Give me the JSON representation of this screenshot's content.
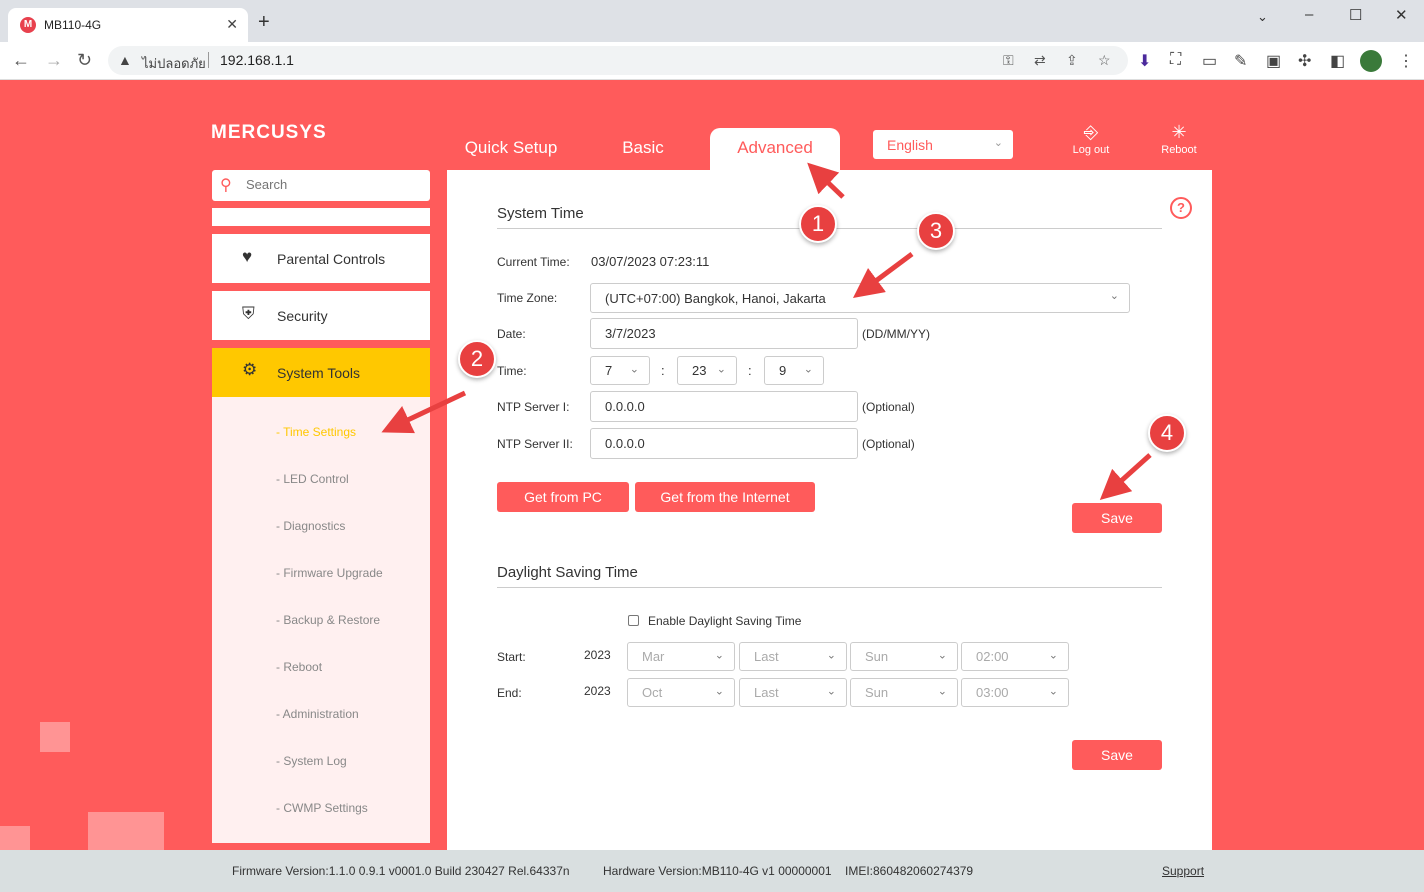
{
  "browser": {
    "tab_title": "MB110-4G",
    "favicon_letter": "M",
    "close_glyph": "✕",
    "new_tab_glyph": "+",
    "win_min": "–",
    "win_max": "☐",
    "win_close": "✕",
    "security_label": "ไม่ปลอดภัย",
    "url": "192.168.1.1"
  },
  "header": {
    "logo": "MERCUSYS",
    "tabs": [
      "Quick Setup",
      "Basic",
      "Advanced"
    ],
    "language": "English",
    "logout": "Log out",
    "reboot": "Reboot"
  },
  "sidebar": {
    "search_placeholder": "Search",
    "items": [
      {
        "label": "Parental Controls",
        "icon": "heart-icon"
      },
      {
        "label": "Security",
        "icon": "shield-icon"
      },
      {
        "label": "System Tools",
        "icon": "gear-icon"
      }
    ],
    "sub_items": [
      "- Time Settings",
      "- LED Control",
      "- Diagnostics",
      "- Firmware Upgrade",
      "- Backup & Restore",
      "- Reboot",
      "- Administration",
      "- System Log",
      "- CWMP Settings"
    ]
  },
  "system_time": {
    "title": "System Time",
    "current_time_label": "Current Time:",
    "current_time": "03/07/2023 07:23:11",
    "time_zone_label": "Time Zone:",
    "time_zone": "(UTC+07:00) Bangkok, Hanoi, Jakarta",
    "date_label": "Date:",
    "date": "3/7/2023",
    "date_format": "(DD/MM/YY)",
    "time_label": "Time:",
    "hour": "7",
    "minute": "23",
    "second": "9",
    "colon": ":",
    "ntp1_label": "NTP Server I:",
    "ntp1": "0.0.0.0",
    "ntp2_label": "NTP Server II:",
    "ntp2": "0.0.0.0",
    "optional": "(Optional)",
    "get_from_pc": "Get from PC",
    "get_from_internet": "Get from the Internet",
    "save": "Save"
  },
  "dst": {
    "title": "Daylight Saving Time",
    "enable_label": "Enable Daylight Saving Time",
    "start_label": "Start:",
    "end_label": "End:",
    "start": {
      "year": "2023",
      "month": "Mar",
      "week": "Last",
      "day": "Sun",
      "time": "02:00"
    },
    "end": {
      "year": "2023",
      "month": "Oct",
      "week": "Last",
      "day": "Sun",
      "time": "03:00"
    },
    "save": "Save"
  },
  "footer": {
    "firmware": "Firmware Version:1.1.0 0.9.1 v0001.0 Build 230427 Rel.64337n",
    "hardware": "Hardware Version:MB110-4G v1 00000001",
    "imei": "IMEI:860482060274379",
    "support": "Support"
  },
  "annotations": {
    "steps": [
      "1",
      "2",
      "3",
      "4"
    ],
    "color": "#e84040"
  },
  "colors": {
    "brand": "#ff5b5b",
    "active_menu": "#ffc800",
    "active_sub": "#ffc800"
  }
}
